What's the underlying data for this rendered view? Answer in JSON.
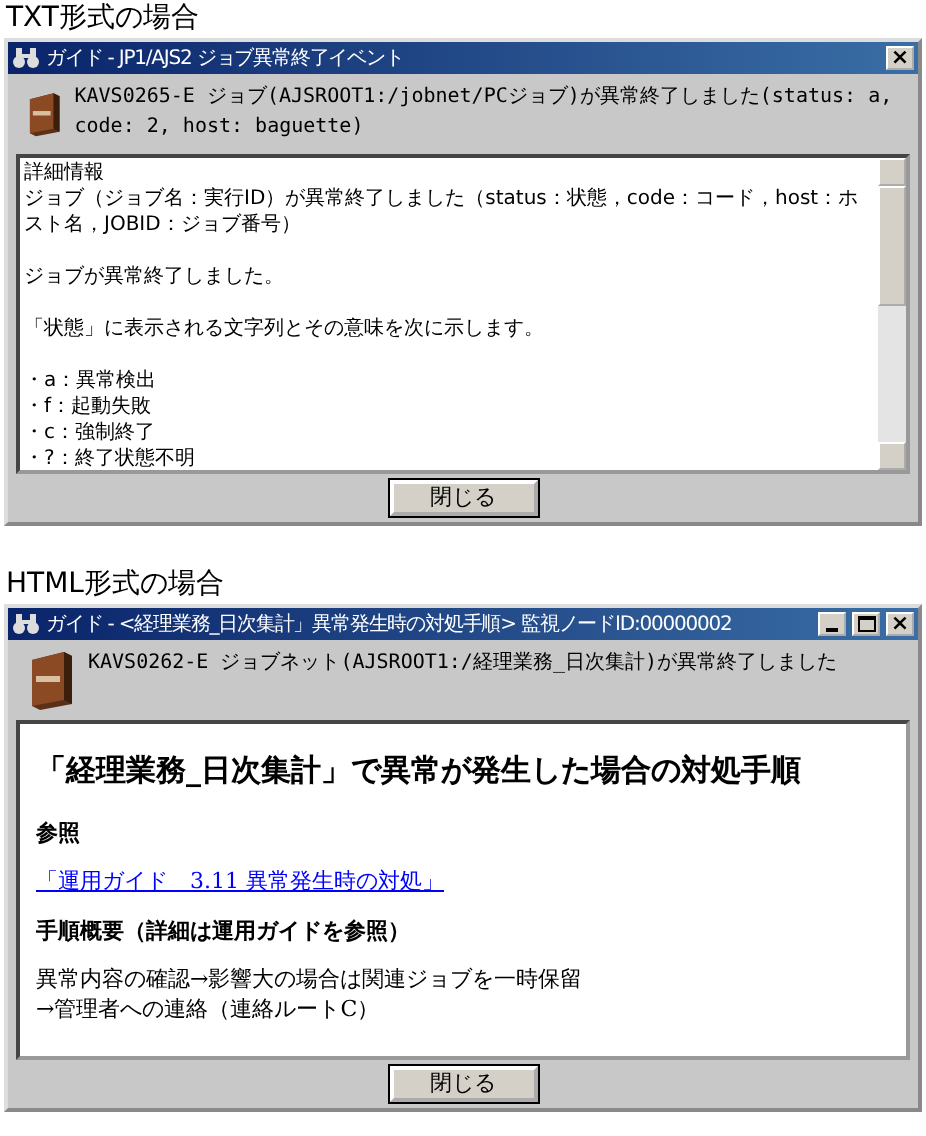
{
  "sections": [
    {
      "caption": "TXT形式の場合",
      "window": {
        "title": "ガイド - JP1/AJS2 ジョブ異常終了イベント",
        "title_buttons": [
          {
            "kind": "close",
            "glyph": "×"
          }
        ],
        "message": "KAVS0265-E ジョブ(AJSROOT1:/jobnet/PCジョブ)が異常終了しました(status: a, code: 2, host: baguette)",
        "body": {
          "kind": "text",
          "paragraphs": [
            {
              "lines": [
                "詳細情報",
                "ジョブ（ジョブ名：実行ID）が異常終了しました（status：状態，code：コード，host：ホスト名，JOBID：ジョブ番号）"
              ]
            },
            {
              "lines": [
                "ジョブが異常終了しました。"
              ]
            },
            {
              "lines": [
                "「状態」に表示される文字列とその意味を次に示します。"
              ]
            },
            {
              "lines": [
                "・a：異常検出",
                "・f：起動失敗",
                "・c：強制終了",
                "・?：終了状態不明"
              ]
            }
          ]
        },
        "button": "閉じる"
      }
    },
    {
      "caption": "HTML形式の場合",
      "window": {
        "title": "ガイド - <経理業務_日次集計」異常発生時の対処手順> 監視ノードID:00000002",
        "title_buttons": [
          {
            "kind": "minimize"
          },
          {
            "kind": "maximize"
          },
          {
            "kind": "close",
            "glyph": "×"
          }
        ],
        "message": "KAVS0262-E ジョブネット(AJSROOT1:/経理業務_日次集計)が異常終了しました",
        "body": {
          "kind": "html",
          "items": [
            {
              "kind": "heading",
              "text": "「経理業務_日次集計」で異常が発生した場合の対処手順"
            },
            {
              "kind": "label",
              "text": "参照"
            },
            {
              "kind": "link",
              "text": "「運用ガイド　3.11 異常発生時の対処」"
            },
            {
              "kind": "label",
              "text": "手順概要（詳細は運用ガイドを参照）"
            },
            {
              "kind": "paragraph",
              "lines": [
                "異常内容の確認→影響大の場合は関連ジョブを一時保留",
                "→管理者への連絡（連絡ルートC）"
              ]
            }
          ]
        },
        "button": "閉じる"
      }
    }
  ]
}
